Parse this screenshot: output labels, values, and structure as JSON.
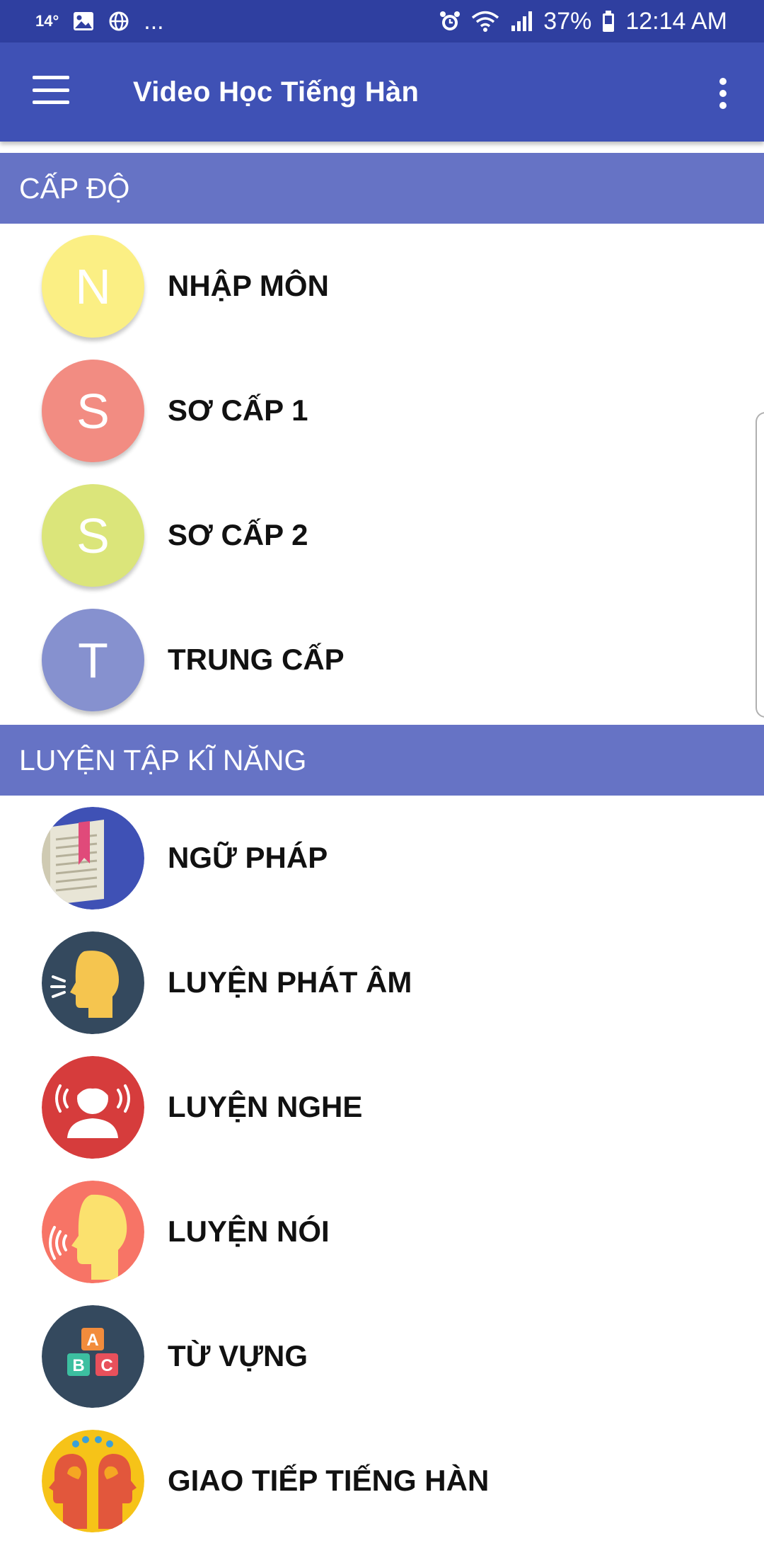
{
  "statusbar": {
    "temp": "14°",
    "more": "...",
    "battery": "37%",
    "time": "12:14 AM"
  },
  "appbar": {
    "title": "Video Học Tiếng Hàn"
  },
  "sections": [
    {
      "header": "CẤP ĐỘ",
      "items": [
        {
          "letter": "N",
          "label": "NHẬP MÔN",
          "color": "#fbef84"
        },
        {
          "letter": "S",
          "label": "SƠ CẤP 1",
          "color": "#f28c82"
        },
        {
          "letter": "S",
          "label": "SƠ CẤP 2",
          "color": "#dbe57a"
        },
        {
          "letter": "T",
          "label": "TRUNG CẤP",
          "color": "#8691cf"
        }
      ]
    },
    {
      "header": "LUYỆN TẬP KĨ NĂNG",
      "items": [
        {
          "icon": "grammar-book-icon",
          "label": "NGỮ PHÁP",
          "color": "#3f51b5"
        },
        {
          "icon": "pronunciation-icon",
          "label": "LUYỆN PHÁT ÂM",
          "color": "#34495e"
        },
        {
          "icon": "listening-icon",
          "label": "LUYỆN NGHE",
          "color": "#d63c3c"
        },
        {
          "icon": "speaking-icon",
          "label": "LUYỆN NÓI",
          "color": "#f77466"
        },
        {
          "icon": "vocabulary-abc-icon",
          "label": "TỪ VỰNG",
          "color": "#34495e"
        },
        {
          "icon": "communication-icon",
          "label": "GIAO TIẾP TIẾNG HÀN",
          "color": "#f6c318"
        }
      ]
    }
  ]
}
